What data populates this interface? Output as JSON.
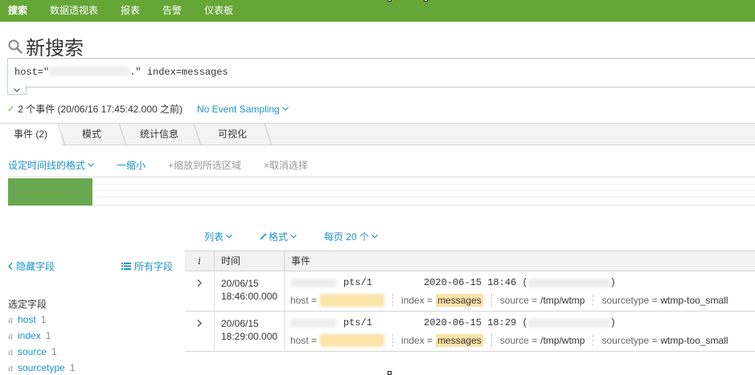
{
  "topnav": {
    "items": [
      {
        "label": "搜索"
      },
      {
        "label": "数据透视表"
      },
      {
        "label": "报表"
      },
      {
        "label": "告警"
      },
      {
        "label": "仪表板"
      }
    ]
  },
  "header": {
    "title": "新搜索"
  },
  "search": {
    "query_prefix": "host=\"",
    "query_suffix": ".\" index=messages"
  },
  "status": {
    "events_text": "2 个事件 (20/06/16 17:45:42.000 之前)",
    "sampling": "No Event Sampling"
  },
  "tabs": [
    {
      "label": "事件 (2)"
    },
    {
      "label": "模式"
    },
    {
      "label": "统计信息"
    },
    {
      "label": "可视化"
    }
  ],
  "timeline_tools": {
    "format": "设定时间线的格式",
    "zoom_out": "一缩小",
    "zoom_selection": "+缩放到所选区域",
    "deselect": "×取消选择"
  },
  "list_controls": {
    "list": "列表",
    "format": "格式",
    "per_page": "每页 20 个"
  },
  "sidebar": {
    "hide_fields": "隐藏字段",
    "all_fields": "所有字段",
    "selected_title": "选定字段",
    "fields": [
      {
        "type": "a",
        "name": "host",
        "count": "1"
      },
      {
        "type": "a",
        "name": "index",
        "count": "1"
      },
      {
        "type": "a",
        "name": "source",
        "count": "1"
      },
      {
        "type": "a",
        "name": "sourcetype",
        "count": "1"
      }
    ]
  },
  "events": {
    "columns": {
      "i": "i",
      "time": "时间",
      "event": "事件"
    },
    "rows": [
      {
        "date": "20/06/15",
        "time": "18:46:00.000",
        "raw_tty": "pts/1",
        "raw_time": "2020-06-15 18:46 (",
        "raw_end": ")",
        "host_key": "host =",
        "index_key": "index =",
        "index_val": "messages",
        "source_key": "source =",
        "source_val": "/tmp/wtmp",
        "sourcetype_key": "sourcetype =",
        "sourcetype_val": "wtmp-too_small"
      },
      {
        "date": "20/06/15",
        "time": "18:29:00.000",
        "raw_tty": "pts/1",
        "raw_time": "2020-06-15 18:29 (",
        "raw_end": ")",
        "host_key": "host =",
        "index_key": "index =",
        "index_val": "messages",
        "source_key": "source =",
        "source_val": "/tmp/wtmp",
        "sourcetype_key": "sourcetype =",
        "sourcetype_val": "wtmp-too_small"
      }
    ]
  },
  "colors": {
    "brand_green": "#65a637",
    "link_blue": "#1e93c6",
    "highlight": "#fbe4a9",
    "timeline_bar": "#6aa84f"
  }
}
